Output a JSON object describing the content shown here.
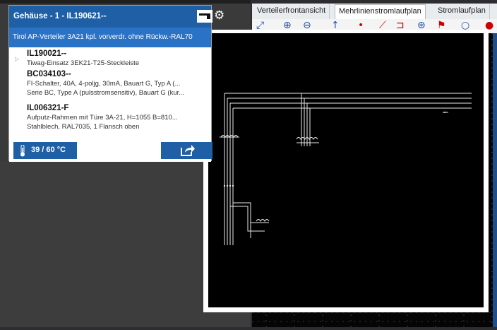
{
  "card": {
    "title": "Gehäuse - 1 - IL190621--",
    "subtitle": "Tirol AP-Verteiler 3A21 kpl. vorverdr. ohne Rückw.-RAL70",
    "items": [
      {
        "code": "IL190021--",
        "lines": [
          "Tiwag-Einsatz 3EK21-T25-Steckleiste"
        ]
      },
      {
        "code": "BC034103--",
        "lines": [
          "FI-Schalter, 40A, 4-poljg, 30mA, Bauart G, Typ A (...",
          "Serie BC, Type A (pulsstromsensitiv), Bauart G (kur..."
        ]
      },
      {
        "code": "IL006321-F",
        "lines": [
          "Aufputz-Rahmen mit Türe 3A-21, H=1055 B=810...",
          "Stahlblech, RAL7035, 1 Flansch oben"
        ]
      }
    ],
    "temperature": "39 / 60 °C"
  },
  "tabs": [
    {
      "label": "Verteilerfrontansicht",
      "active": false
    },
    {
      "label": "Mehrlinienstromlaufplan",
      "active": true
    },
    {
      "label": "Stromlaufplan",
      "active": false
    }
  ],
  "icons": {
    "gear": "gear-icon",
    "thermometer": "thermometer-icon",
    "export": "export-icon",
    "document": "document-icon"
  },
  "colors": {
    "header_blue": "#1f5fa6",
    "subheader_blue": "#2a72c6",
    "drawing_bg": "#000000"
  }
}
